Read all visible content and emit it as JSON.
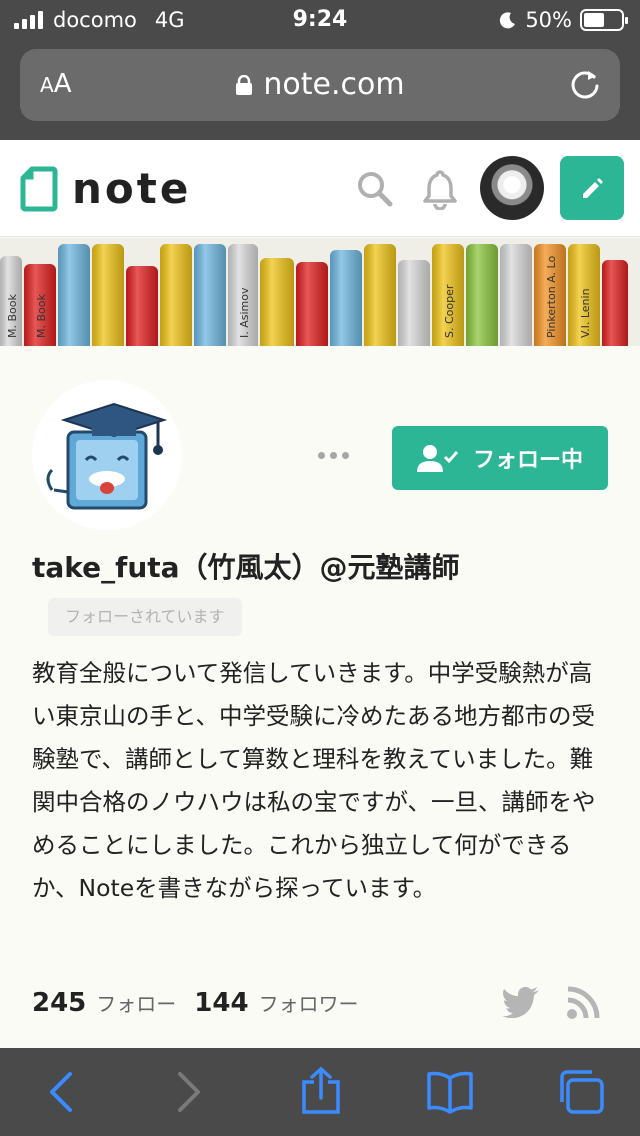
{
  "status_bar": {
    "carrier": "docomo",
    "network": "4G",
    "time": "9:24",
    "battery": "50%",
    "battery_level": 0.5
  },
  "browser": {
    "text_size_label": "AA",
    "url": "note.com"
  },
  "header": {
    "logo_text": "note",
    "brand_color": "#2cb696"
  },
  "banner": {
    "book_titles": [
      "M. Book",
      "M. Book",
      "I. Asimov",
      "S. Cooper",
      "Pinkerton A. Lo",
      "V.I. Lenin"
    ]
  },
  "profile": {
    "follow_button_label": "フォロー中",
    "name": "take_futa（竹風太）@元塾講師",
    "follows_you_label": "フォローされています",
    "bio": "教育全般について発信していきます。中学受験熱が高い東京山の手と、中学受験に冷めたある地方都市の受験塾で、講師として算数と理科を教えていました。難関中合格のノウハウは私の宝ですが、一旦、講師をやめることにしました。これから独立して何ができるか、Noteを書きながら探っています。",
    "following_count": "245",
    "following_label": "フォロー",
    "followers_count": "144",
    "followers_label": "フォロワー"
  },
  "icons": [
    "search-icon",
    "bell-icon",
    "pencil-icon",
    "more-icon",
    "twitter-icon",
    "rss-icon",
    "back-icon",
    "forward-icon",
    "share-icon",
    "bookmarks-icon",
    "tabs-icon"
  ]
}
